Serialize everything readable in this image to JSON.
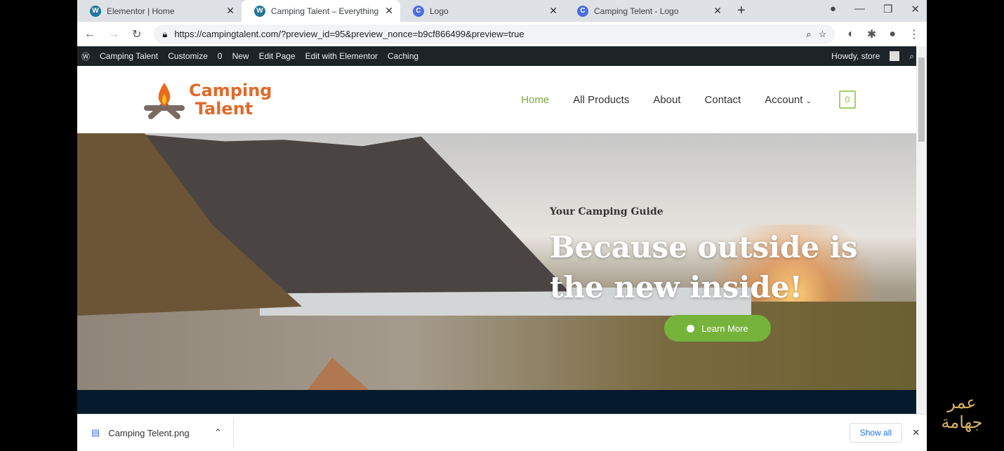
{
  "browser": {
    "tabs": [
      {
        "label": "Elementor | Home",
        "icon": "wordpress-icon"
      },
      {
        "label": "Camping Talent – Everything you",
        "icon": "wordpress-icon",
        "active": true
      },
      {
        "label": "Logo",
        "icon": "canva-icon"
      },
      {
        "label": "Camping Telent - Logo",
        "icon": "canva-icon"
      }
    ],
    "url": "https://campingtalent.com/?preview_id=95&preview_nonce=b9cf866499&preview=true"
  },
  "wpbar": {
    "site": "Camping Talent",
    "customize": "Customize",
    "comments": "0",
    "new": "New",
    "edit_page": "Edit Page",
    "elementor": "Edit with Elementor",
    "caching": "Caching",
    "howdy": "Howdy, store"
  },
  "site": {
    "logo": "Camping Talent",
    "nav": [
      "Home",
      "All Products",
      "About",
      "Contact",
      "Account"
    ],
    "cart_count": "0",
    "accent": "#75b33a"
  },
  "hero": {
    "subtitle": "Your Camping Guide",
    "title": "Because outside is the new inside!",
    "button": "Learn More"
  },
  "downloads": {
    "file": "Camping Telent.png",
    "show_all": "Show all"
  },
  "watermark": "عمر جهامة"
}
